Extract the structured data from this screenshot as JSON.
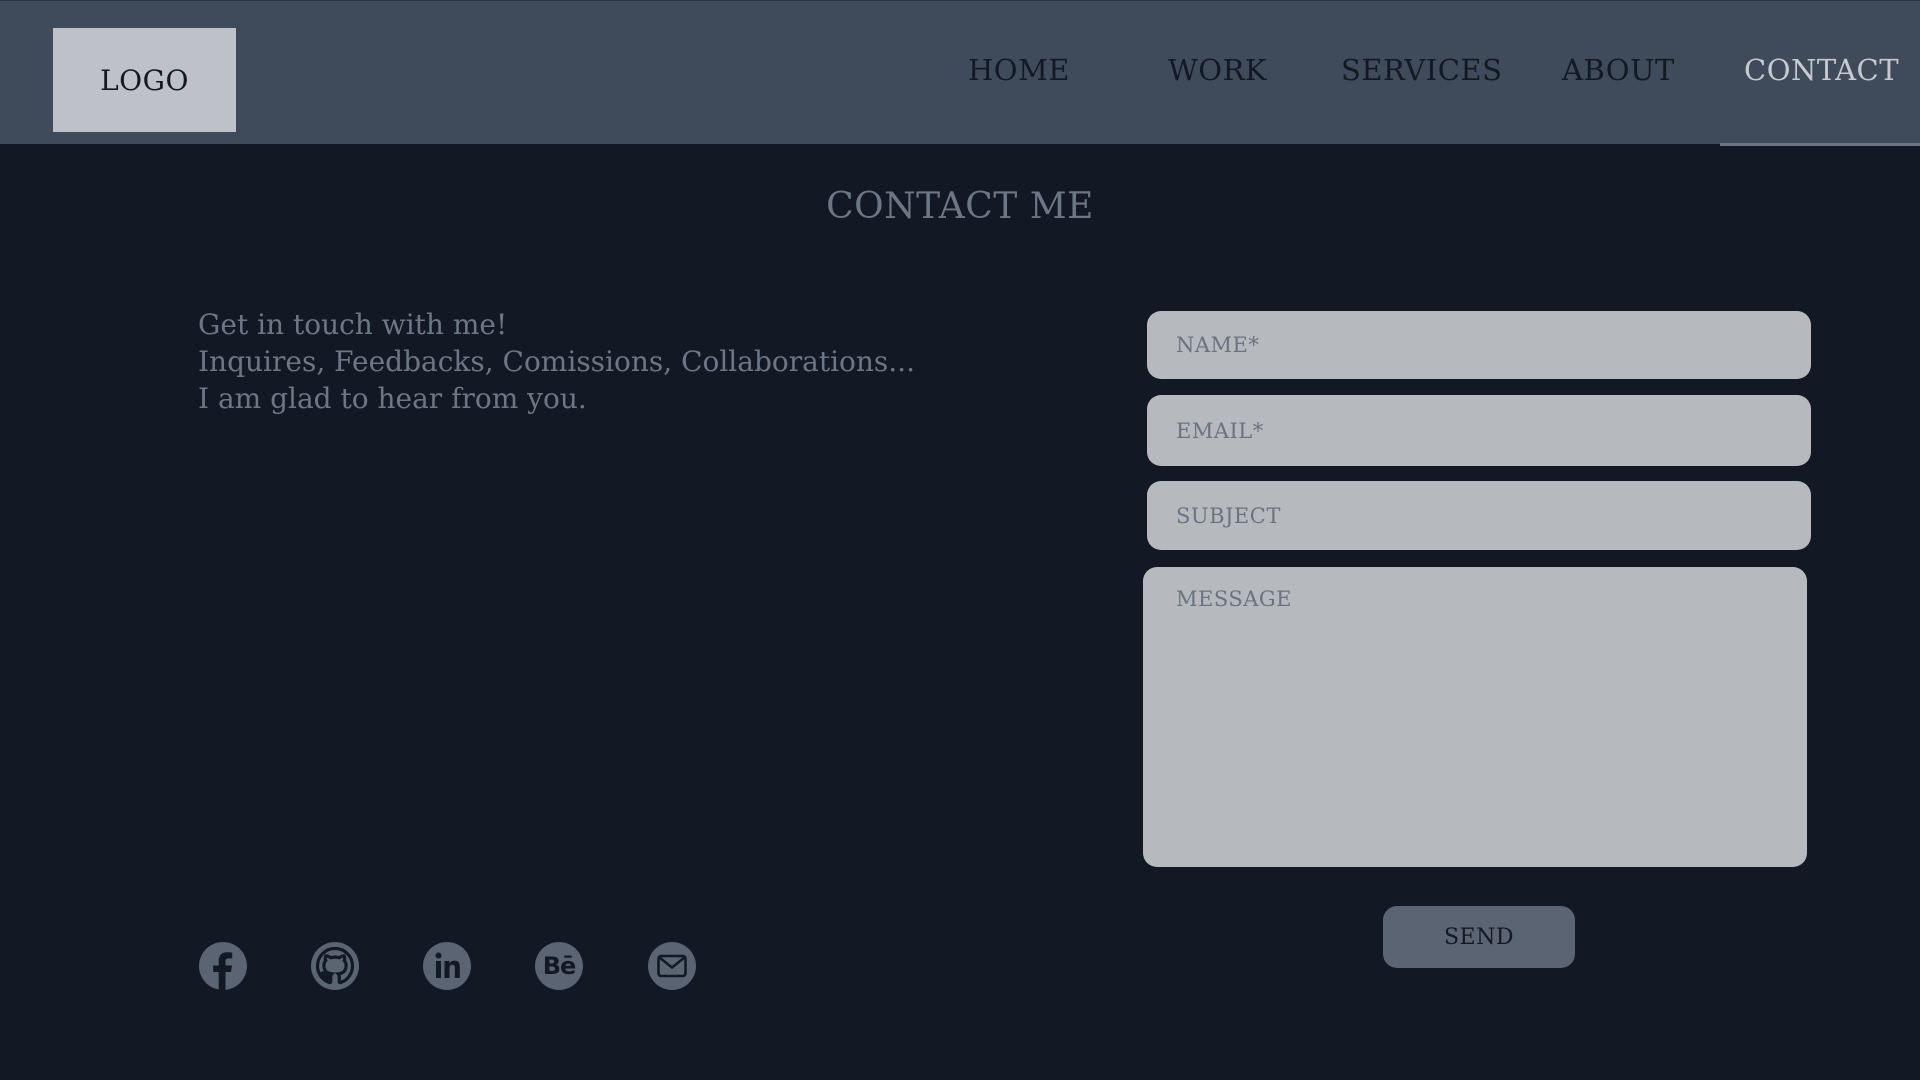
{
  "header": {
    "logo": "LOGO",
    "nav": [
      {
        "label": "HOME"
      },
      {
        "label": "WORK"
      },
      {
        "label": "SERVICES"
      },
      {
        "label": "ABOUT"
      },
      {
        "label": "CONTACT",
        "active": true
      }
    ]
  },
  "main": {
    "title": "CONTACT ME",
    "intro": [
      "Get in touch with me!",
      "Inquires, Feedbacks, Comissions, Collaborations...",
      "I am glad to hear from you."
    ]
  },
  "form": {
    "name_placeholder": "NAME*",
    "email_placeholder": "EMAIL*",
    "subject_placeholder": "SUBJECT",
    "message_placeholder": "MESSAGE",
    "send_label": "SEND"
  },
  "social": [
    {
      "icon": "facebook-icon"
    },
    {
      "icon": "github-icon"
    },
    {
      "icon": "linkedin-icon"
    },
    {
      "icon": "behance-icon"
    },
    {
      "icon": "email-icon"
    }
  ],
  "colors": {
    "page_background": "#131924",
    "header_background": "#3f4b5a",
    "field_background": "#b6b9bd",
    "button_background": "#5a6473",
    "muted_text": "#6d7684"
  }
}
